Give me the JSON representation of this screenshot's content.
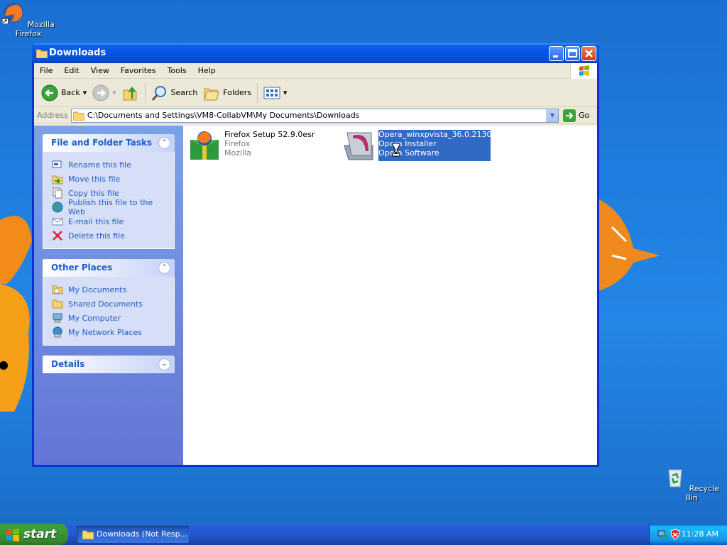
{
  "desktop": {
    "icons": [
      {
        "label": "Mozilla Firefox"
      },
      {
        "label": "Recycle Bin"
      }
    ]
  },
  "window": {
    "title": "Downloads",
    "menu": [
      "File",
      "Edit",
      "View",
      "Favorites",
      "Tools",
      "Help"
    ],
    "toolbar": {
      "back_label": "Back",
      "search_label": "Search",
      "folders_label": "Folders"
    },
    "address": {
      "label": "Address",
      "value": "C:\\Documents and Settings\\VM8-CollabVM\\My Documents\\Downloads",
      "go_label": "Go"
    },
    "taskpane": {
      "file_tasks": {
        "title": "File and Folder Tasks",
        "items": [
          {
            "label": "Rename this file",
            "icon": "rename-icon"
          },
          {
            "label": "Move this file",
            "icon": "move-icon"
          },
          {
            "label": "Copy this file",
            "icon": "copy-icon"
          },
          {
            "label": "Publish this file to the Web",
            "icon": "globe-icon"
          },
          {
            "label": "E-mail this file",
            "icon": "email-icon"
          },
          {
            "label": "Delete this file",
            "icon": "delete-icon"
          }
        ]
      },
      "other_places": {
        "title": "Other Places",
        "items": [
          {
            "label": "My Documents",
            "icon": "folder-icon"
          },
          {
            "label": "Shared Documents",
            "icon": "folder-icon"
          },
          {
            "label": "My Computer",
            "icon": "computer-icon"
          },
          {
            "label": "My Network Places",
            "icon": "network-icon"
          }
        ]
      },
      "details": {
        "title": "Details"
      }
    },
    "files": [
      {
        "name": "Firefox Setup 52.9.0esr",
        "line2": "Firefox",
        "line3": "Mozilla",
        "selected": false
      },
      {
        "name": "Opera_winxpvista_36.0.2130...",
        "line2": "Opera Installer",
        "line3": "Opera Software",
        "selected": true
      }
    ]
  },
  "taskbar": {
    "start_label": "start",
    "task_button": "Downloads (Not Resp...",
    "clock": "11:28 AM"
  },
  "colors": {
    "desktop_blue": "#1f7fe0",
    "title_blue": "#0554e3",
    "task_link": "#215dc6",
    "selection": "#316ac5",
    "start_green": "#3f9f3f"
  }
}
